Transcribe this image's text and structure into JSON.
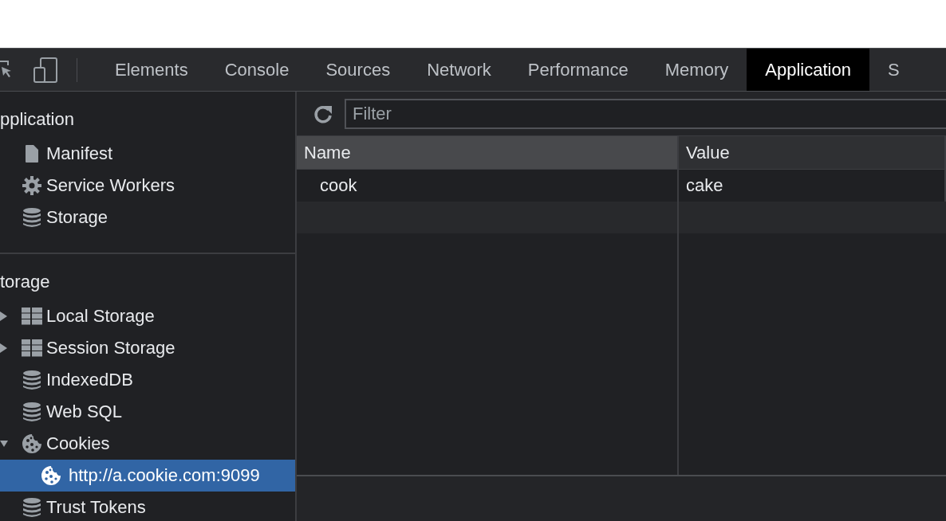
{
  "toolbar": {
    "tabs": [
      {
        "label": "Elements",
        "selected": false
      },
      {
        "label": "Console",
        "selected": false
      },
      {
        "label": "Sources",
        "selected": false
      },
      {
        "label": "Network",
        "selected": false
      },
      {
        "label": "Performance",
        "selected": false
      },
      {
        "label": "Memory",
        "selected": false
      },
      {
        "label": "Application",
        "selected": true
      },
      {
        "label": "S",
        "selected": false
      }
    ]
  },
  "sidebar": {
    "sections": [
      {
        "title": "pplication",
        "items": [
          {
            "label": "Manifest",
            "kind": "file",
            "selected": false
          },
          {
            "label": "Service Workers",
            "kind": "gear",
            "selected": false
          },
          {
            "label": "Storage",
            "kind": "database",
            "selected": false
          }
        ]
      },
      {
        "title": "torage",
        "items": [
          {
            "label": "Local Storage",
            "kind": "table",
            "expanded": false,
            "selected": false
          },
          {
            "label": "Session Storage",
            "kind": "table",
            "expanded": false,
            "selected": false
          },
          {
            "label": "IndexedDB",
            "kind": "database",
            "selected": false
          },
          {
            "label": "Web SQL",
            "kind": "database",
            "selected": false
          },
          {
            "label": "Cookies",
            "kind": "cookie",
            "expanded": true,
            "selected": false,
            "children": [
              {
                "label": "http://a.cookie.com:9099",
                "kind": "cookie",
                "selected": true
              }
            ]
          },
          {
            "label": "Trust Tokens",
            "kind": "database",
            "selected": false
          }
        ]
      }
    ]
  },
  "filter": {
    "placeholder": "Filter"
  },
  "table": {
    "columns": [
      "Name",
      "Value"
    ],
    "rows": [
      {
        "name": "cook",
        "value": "cake"
      }
    ]
  }
}
